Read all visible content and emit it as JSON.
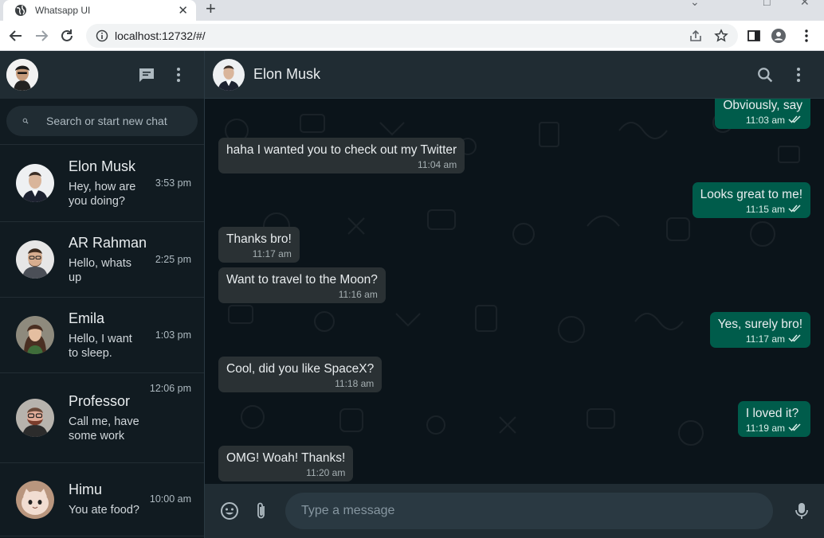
{
  "browser": {
    "tab_title": "Whatsapp UI",
    "url": "localhost:12732/#/"
  },
  "sidebar": {
    "search_placeholder": "Search or start new chat",
    "chats": [
      {
        "name": "Elon Musk",
        "preview": "Hey, how are you doing?",
        "time": "3:53 pm"
      },
      {
        "name": "AR Rahman",
        "preview": "Hello, whats up",
        "time": "2:25 pm"
      },
      {
        "name": "Emila",
        "preview": "Hello, I want to sleep.",
        "time": "1:03 pm"
      },
      {
        "name": "Professor",
        "preview": "Call me, have some work",
        "time": "12:06 pm"
      },
      {
        "name": "Himu",
        "preview": "You ate food?",
        "time": "10:00 am"
      }
    ]
  },
  "conversation": {
    "name": "Elon Musk",
    "composer_placeholder": "Type a message",
    "messages": [
      {
        "dir": "out",
        "text": "Obviously, say",
        "time": "11:03 am"
      },
      {
        "dir": "in",
        "text": "haha I wanted you to check out my Twitter",
        "time": "11:04 am"
      },
      {
        "dir": "out",
        "text": "Looks great to me!",
        "time": "11:15 am"
      },
      {
        "dir": "in",
        "text": "Thanks bro!",
        "time": "11:17 am"
      },
      {
        "dir": "in",
        "text": "Want to travel to the Moon?",
        "time": "11:16 am"
      },
      {
        "dir": "out",
        "text": "Yes, surely bro!",
        "time": "11:17 am"
      },
      {
        "dir": "in",
        "text": "Cool, did you like SpaceX?",
        "time": "11:18 am"
      },
      {
        "dir": "out",
        "text": "I loved it?",
        "time": "11:19 am"
      },
      {
        "dir": "in",
        "text": "OMG! Woah! Thanks!",
        "time": "11:20 am"
      }
    ]
  },
  "colors": {
    "accent": "#005c4b",
    "panel": "#202c33",
    "background": "#111b21"
  }
}
